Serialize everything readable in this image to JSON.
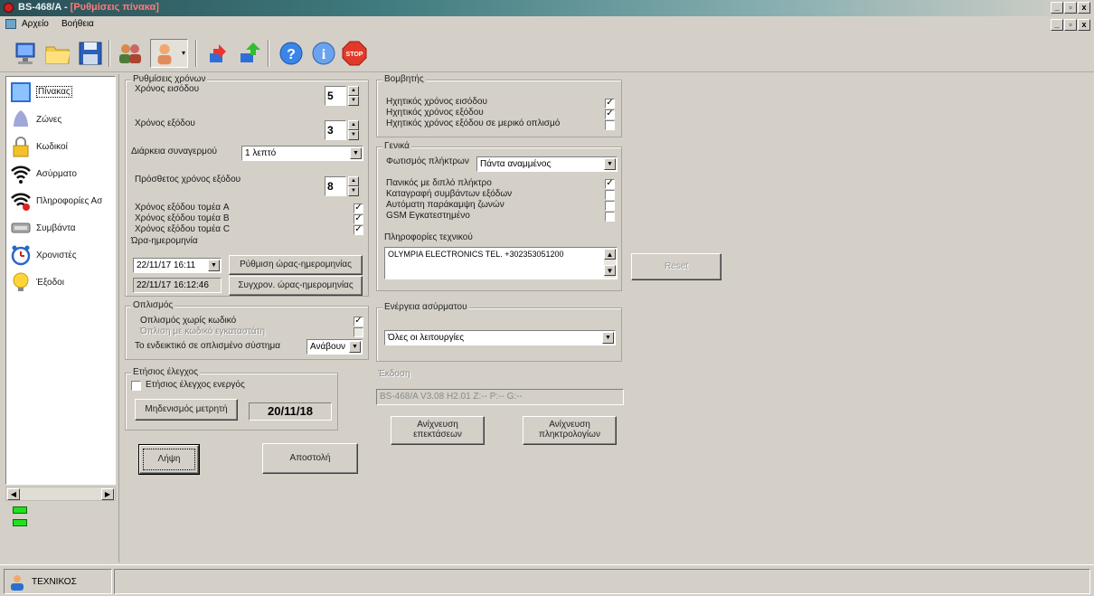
{
  "window": {
    "title": "BS-468/A - ",
    "subtitle": "[Ρυθμίσεις πίνακα]"
  },
  "menu": [
    "Αρχείο",
    "Βοήθεια"
  ],
  "toolbar": [
    {
      "icon": "computer-icon"
    },
    {
      "icon": "folder-open-icon"
    },
    {
      "icon": "save-icon"
    },
    {
      "icon": "users-icon"
    },
    {
      "icon": "user-dropdown-icon"
    },
    {
      "icon": "download-icon"
    },
    {
      "icon": "upload-icon"
    },
    {
      "icon": "help-icon"
    },
    {
      "icon": "info-icon"
    },
    {
      "icon": "stop-icon"
    }
  ],
  "sidebar": {
    "items": [
      {
        "label": "Πίνακας",
        "icon": "panel-icon"
      },
      {
        "label": "Ζώνες",
        "icon": "zones-icon"
      },
      {
        "label": "Κωδικοί",
        "icon": "lock-icon"
      },
      {
        "label": "Ασύρματο",
        "icon": "wireless-icon"
      },
      {
        "label": "Πληροφορίες Ασ",
        "icon": "wireless-info-icon"
      },
      {
        "label": "Συμβάντα",
        "icon": "events-icon"
      },
      {
        "label": "Χρονιστές",
        "icon": "clock-icon"
      },
      {
        "label": "Έξοδοι",
        "icon": "bulb-icon"
      }
    ]
  },
  "timing": {
    "title": "Ρυθμίσεις χρόνων",
    "entry_label": "Χρόνος εισόδου",
    "entry_value": "5",
    "exit_label": "Χρόνος εξόδου",
    "exit_value": "3",
    "siren_label": "Διάρκεια συναγερμού",
    "siren_value": "1 λεπτό",
    "extra_exit_label": "Πρόσθετος χρόνος εξόδου",
    "extra_exit_value": "8",
    "exit_a": "Χρόνος εξόδου τομέα A",
    "exit_b": "Χρόνος εξόδου τομέα B",
    "exit_c": "Χρόνος εξόδου τομέα C",
    "datetime_label": "Ώρα-ημερομηνία",
    "datetime_value": "22/11/17  16:11",
    "datetime_readonly": "22/11/17  16:12:46",
    "set_datetime_button": "Ρύθμιση ώρας-ημερομηνίας",
    "sync_datetime_button": "Συγχρον. ώρας-ημερομηνίας"
  },
  "arming": {
    "title": "Οπλισμός",
    "no_code": "Οπλισμός χωρίς κωδικό",
    "installer_code": "Όπλιση με κωδικό εγκαταστάτη",
    "indicator_label": "Το ενδεικτικό σε οπλισμένο σύστημα",
    "indicator_value": "Ανάβουν"
  },
  "annual": {
    "title": "Ετήσιος έλεγχος",
    "active_label": "Ετήσιος έλεγχος ενεργός",
    "reset_button": "Μηδενισμός μετρητή",
    "date": "20/11/18"
  },
  "buzzer": {
    "title": "Βομβητής",
    "entry": "Ηχητικός χρόνος εισόδου",
    "exit": "Ηχητικός χρόνος εξόδου",
    "exit_partial": "Ηχητικός χρόνος εξόδου σε μερικό οπλισμό"
  },
  "general": {
    "title": "Γενικά",
    "keypad_light_label": "Φωτισμός πλήκτρων",
    "keypad_light_value": "Πάντα αναμμένος",
    "panic": "Πανικός με διπλό πλήκτρο",
    "log_exit": "Καταγραφή συμβάντων εξόδων",
    "auto_bypass": "Αυτόματη παράκαμψη ζωνών",
    "gsm": "GSM Εγκατεστημένο",
    "tech_info_label": "Πληροφορίες τεχνικού",
    "tech_info_value": "OLYMPIA ELECTRONICS   TEL. +302353051200"
  },
  "reset_button": "Reset",
  "wireless_action": {
    "title": "Ενέργεια ασύρματου",
    "value": "Όλες οι λειτουργίες"
  },
  "version": {
    "title": "Έκδοση",
    "value": "BS-468/A V3.08 H2.01 Z:-- P:-- G:--"
  },
  "detect_extensions_button_l1": "Ανίχνευση",
  "detect_extensions_button_l2": "επεκτάσεων",
  "detect_keypads_button_l1": "Ανίχνευση",
  "detect_keypads_button_l2": "πληκτρολογίων",
  "receive_button": "Λήψη",
  "send_button": "Αποστολή",
  "status": {
    "user": "ΤΕΧΝΙΚΟΣ"
  }
}
